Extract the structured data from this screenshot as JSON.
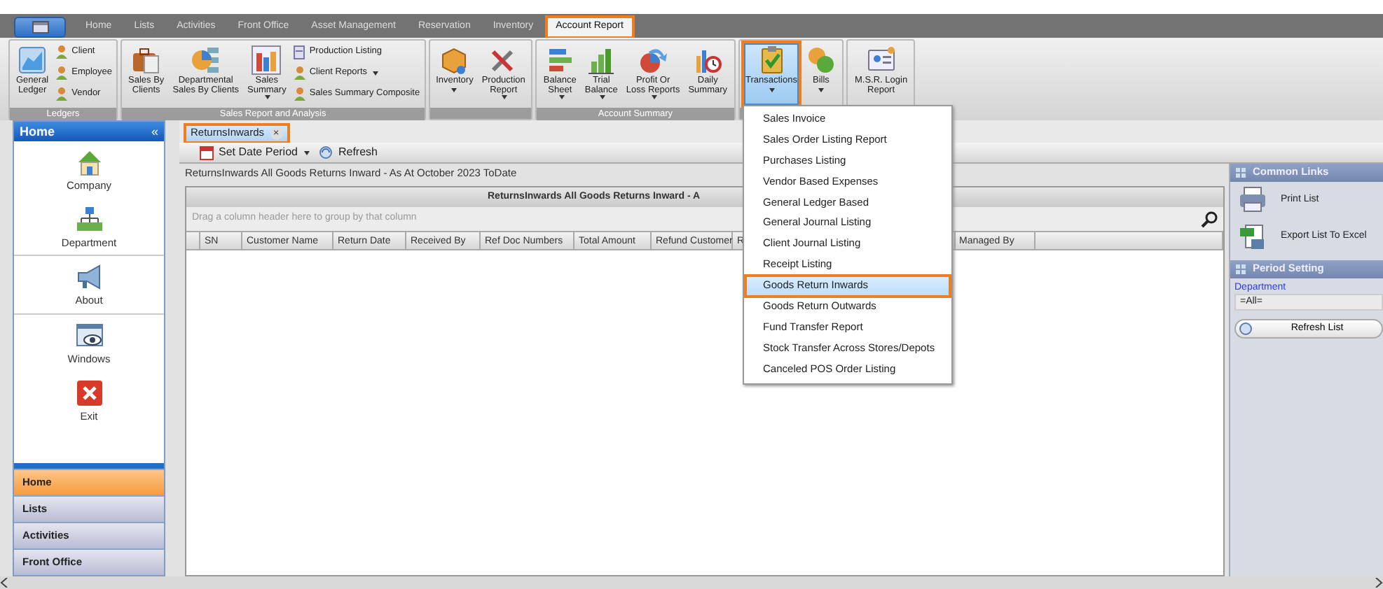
{
  "ribbon_tabs": [
    {
      "label": "Home",
      "selected": false,
      "highlighted": false
    },
    {
      "label": "Lists",
      "selected": false,
      "highlighted": false
    },
    {
      "label": "Activities",
      "selected": false,
      "highlighted": false
    },
    {
      "label": "Front Office",
      "selected": false,
      "highlighted": false
    },
    {
      "label": "Asset Management",
      "selected": false,
      "highlighted": false
    },
    {
      "label": "Reservation",
      "selected": false,
      "highlighted": false
    },
    {
      "label": "Inventory",
      "selected": false,
      "highlighted": false
    },
    {
      "label": "Account Report",
      "selected": true,
      "highlighted": true
    }
  ],
  "ribbon_groups": [
    {
      "label": "Ledgers",
      "items": [
        {
          "kind": "large",
          "label": "General\nLedger",
          "dropdown": false,
          "pressed": false,
          "highlighted": false
        },
        {
          "kind": "small",
          "label": "Client",
          "dropdown": false,
          "highlighted": false
        },
        {
          "kind": "small",
          "label": "Employee",
          "dropdown": false,
          "highlighted": false
        },
        {
          "kind": "small",
          "label": "Vendor",
          "dropdown": false,
          "highlighted": false
        }
      ]
    },
    {
      "label": "Sales Report and Analysis",
      "items": [
        {
          "kind": "large",
          "label": "Sales By\nClients",
          "dropdown": false,
          "pressed": false,
          "highlighted": false
        },
        {
          "kind": "large",
          "label": "Departmental\nSales By Clients",
          "dropdown": false,
          "pressed": false,
          "highlighted": false
        },
        {
          "kind": "large",
          "label": "Sales\nSummary",
          "dropdown": true,
          "pressed": false,
          "highlighted": false
        },
        {
          "kind": "small",
          "label": "Production Listing",
          "dropdown": false,
          "highlighted": false
        },
        {
          "kind": "small",
          "label": "Client Reports",
          "dropdown": true,
          "highlighted": false
        },
        {
          "kind": "small",
          "label": "Sales Summary Composite",
          "dropdown": false,
          "highlighted": false
        }
      ]
    },
    {
      "items": [
        {
          "kind": "large",
          "label": "Inventory",
          "dropdown": true,
          "pressed": false,
          "highlighted": false
        },
        {
          "kind": "large",
          "label": "Production\nReport",
          "dropdown": true,
          "pressed": false,
          "highlighted": false
        }
      ]
    },
    {
      "label": "Account Summary",
      "items": [
        {
          "kind": "large",
          "label": "Balance\nSheet",
          "dropdown": true,
          "pressed": false,
          "highlighted": false
        },
        {
          "kind": "large",
          "label": "Trial\nBalance",
          "dropdown": true,
          "pressed": false,
          "highlighted": false
        },
        {
          "kind": "large",
          "label": "Profit Or\nLoss Reports",
          "dropdown": true,
          "pressed": false,
          "highlighted": false
        },
        {
          "kind": "large",
          "label": "Daily\nSummary",
          "dropdown": false,
          "pressed": false,
          "highlighted": false
        }
      ]
    },
    {
      "items": [
        {
          "kind": "large",
          "label": "Transactions",
          "dropdown": true,
          "pressed": true,
          "highlighted": true
        },
        {
          "kind": "large",
          "label": "Bills",
          "dropdown": true,
          "pressed": false,
          "highlighted": false
        }
      ]
    },
    {
      "items": [
        {
          "kind": "large",
          "label": "M.S.R. Login\nReport",
          "dropdown": false,
          "pressed": false,
          "highlighted": false
        }
      ]
    }
  ],
  "sidebar": {
    "title": "Home",
    "collapse": "«",
    "items": [
      {
        "label": "Company"
      },
      {
        "label": "Department"
      },
      {
        "label": "About"
      },
      {
        "label": "Windows"
      },
      {
        "label": "Exit"
      }
    ],
    "nav_buttons": [
      {
        "label": "Home",
        "selected": true
      },
      {
        "label": "Lists",
        "selected": false
      },
      {
        "label": "Activities",
        "selected": false
      },
      {
        "label": "Front Office",
        "selected": false
      }
    ]
  },
  "document_tabs": [
    {
      "label": "ReturnsInwards",
      "close": "×",
      "highlighted": true
    }
  ],
  "toolbar": [
    {
      "label": "Set Date Period",
      "dropdown": true
    },
    {
      "label": "Refresh",
      "dropdown": false
    }
  ],
  "report_title": "ReturnsInwards All Goods Returns Inward - As At October 2023 ToDate",
  "grid": {
    "caption": "ReturnsInwards All Goods Returns Inward - A",
    "group_panel": "Drag a column header here to group by that column",
    "columns": [
      "SN",
      "Customer Name",
      "Return Date",
      "Received By",
      "Ref Doc Numbers",
      "Total Amount",
      "Refund Customer",
      "R",
      "Managed By"
    ]
  },
  "transactions_menu": [
    {
      "label": "Sales Invoice",
      "selected": false
    },
    {
      "label": "Sales Order Listing Report",
      "selected": false
    },
    {
      "label": "Purchases Listing",
      "selected": false
    },
    {
      "label": "Vendor Based Expenses",
      "selected": false
    },
    {
      "label": "General Ledger Based",
      "selected": false
    },
    {
      "label": "General Journal Listing",
      "selected": false
    },
    {
      "label": "Client Journal Listing",
      "selected": false
    },
    {
      "label": "Receipt Listing",
      "selected": false
    },
    {
      "label": "Goods Return Inwards",
      "selected": true
    },
    {
      "label": "Goods Return Outwards",
      "selected": false
    },
    {
      "label": "Fund Transfer Report",
      "selected": false
    },
    {
      "label": "Stock Transfer Across Stores/Depots",
      "selected": false
    },
    {
      "label": "Canceled POS Order Listing",
      "selected": false
    }
  ],
  "right_panel": {
    "common_links": {
      "title": "Common Links",
      "links": [
        "Print List",
        "Export List To Excel"
      ]
    },
    "period_setting": {
      "title": "Period Setting",
      "department_label": "Department",
      "department_value": "=All=",
      "button": "Refresh List"
    }
  }
}
